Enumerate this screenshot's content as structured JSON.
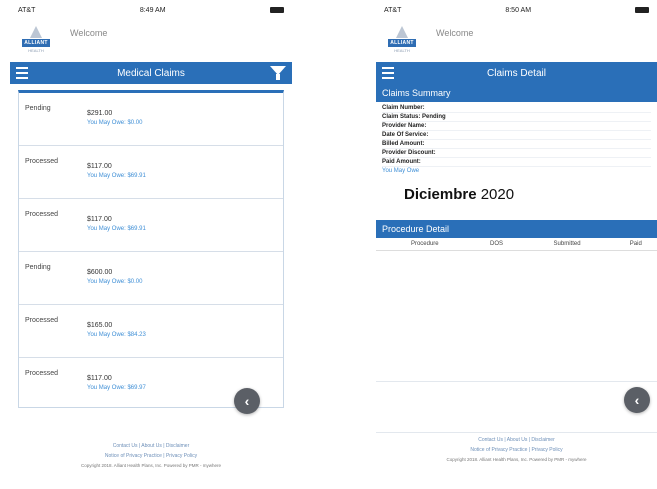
{
  "left": {
    "status_bar": {
      "carrier": "AT&T",
      "time": "8:49 AM"
    },
    "brand": {
      "logo_text": "ALLIANT",
      "logo_sub": "HEALTH",
      "welcome": "Welcome",
      "welcome_sub": ""
    },
    "header": {
      "title": "Medical Claims"
    },
    "claims": [
      {
        "status": "Pending",
        "amount": "$291.00",
        "owe": "You May Owe: $0.00"
      },
      {
        "status": "Processed",
        "amount": "$117.00",
        "owe": "You May Owe: $69.91"
      },
      {
        "status": "Processed",
        "amount": "$117.00",
        "owe": "You May Owe: $69.91"
      },
      {
        "status": "Pending",
        "amount": "$600.00",
        "owe": "You May Owe: $0.00"
      },
      {
        "status": "Processed",
        "amount": "$165.00",
        "owe": "You May Owe: $84.23"
      },
      {
        "status": "Processed",
        "amount": "$117.00",
        "owe": "You May Owe: $69.97"
      }
    ],
    "footer": {
      "contact": "Contact Us",
      "about": "About Us",
      "disclaimer": "Disclaimer",
      "privacy_notice": "Notice of Privacy Practice",
      "privacy_policy": "Privacy Policy",
      "copyright": "Copyright 2018. Alliant Health Plans, Inc. Powered by PMR - mywhere"
    }
  },
  "right": {
    "status_bar": {
      "carrier": "AT&T",
      "time": "8:50 AM"
    },
    "brand": {
      "logo_text": "ALLIANT",
      "logo_sub": "HEALTH",
      "welcome": "Welcome"
    },
    "header": {
      "title": "Claims Detail"
    },
    "summary_title": "Claims Summary",
    "summary_fields": [
      {
        "label": "Claim Number:",
        "value": ""
      },
      {
        "label": "Claim Status:",
        "value": "Pending"
      },
      {
        "label": "Provider Name:",
        "value": ""
      },
      {
        "label": "Date Of Service:",
        "value": ""
      },
      {
        "label": "Billed Amount:",
        "value": ""
      },
      {
        "label": "Provider Discount:",
        "value": ""
      },
      {
        "label": "Paid Amount:",
        "value": ""
      }
    ],
    "summary_link": "You May Owe",
    "overlay_month": "Diciembre",
    "overlay_year": "2020",
    "procedure_title": "Procedure Detail",
    "procedure_columns": [
      "Procedure",
      "DOS",
      "Submitted",
      "Paid"
    ],
    "footer": {
      "contact": "Contact Us",
      "about": "About Us",
      "disclaimer": "Disclaimer",
      "privacy_notice": "Notice of Privacy Practice",
      "privacy_policy": "Privacy Policy",
      "copyright": "Copyright 2018. Alliant Health Plans, Inc. Powered by PMR - mywhere"
    }
  },
  "colors": {
    "brand_blue": "#2a6fb8",
    "link_blue": "#3f8fd6",
    "fab_gray": "#5b5f66"
  },
  "icons": {
    "menu": "hamburger-icon",
    "filter": "filter-icon",
    "back": "chevron-left-icon"
  }
}
